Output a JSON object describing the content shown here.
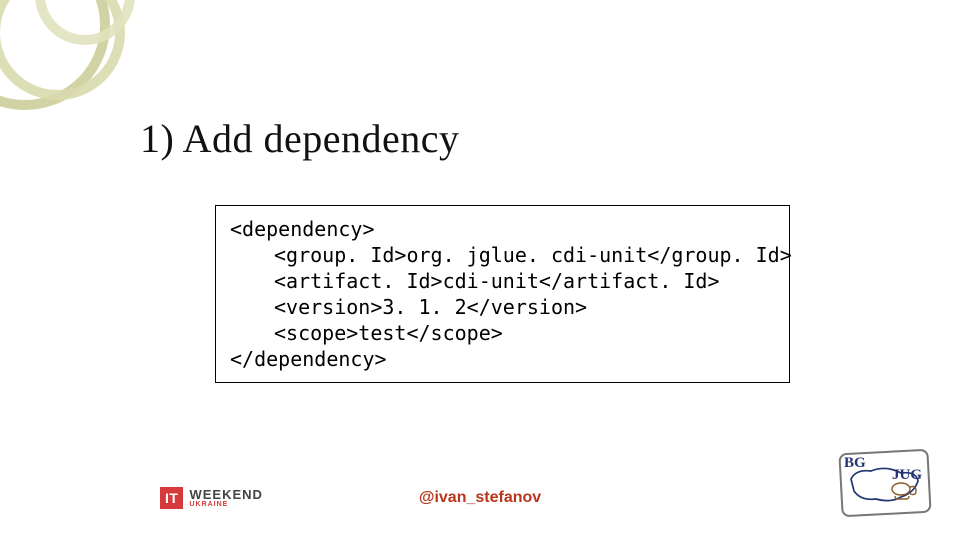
{
  "title": "1) Add dependency",
  "code": {
    "open": "<dependency>",
    "groupId": "<group. Id>org. jglue. cdi-unit</group. Id>",
    "artifactId": "<artifact. Id>cdi-unit</artifact. Id>",
    "version": "<version>3. 1. 2</version>",
    "scope": "<scope>test</scope>",
    "close": "</dependency>"
  },
  "footer": {
    "it": "IT",
    "weekend": "WEEKEND",
    "weekend_sub": "UKRAINE",
    "handle": "@ivan_stefanov",
    "bgjug_bg": "BG",
    "bgjug_jug": "JUG"
  }
}
